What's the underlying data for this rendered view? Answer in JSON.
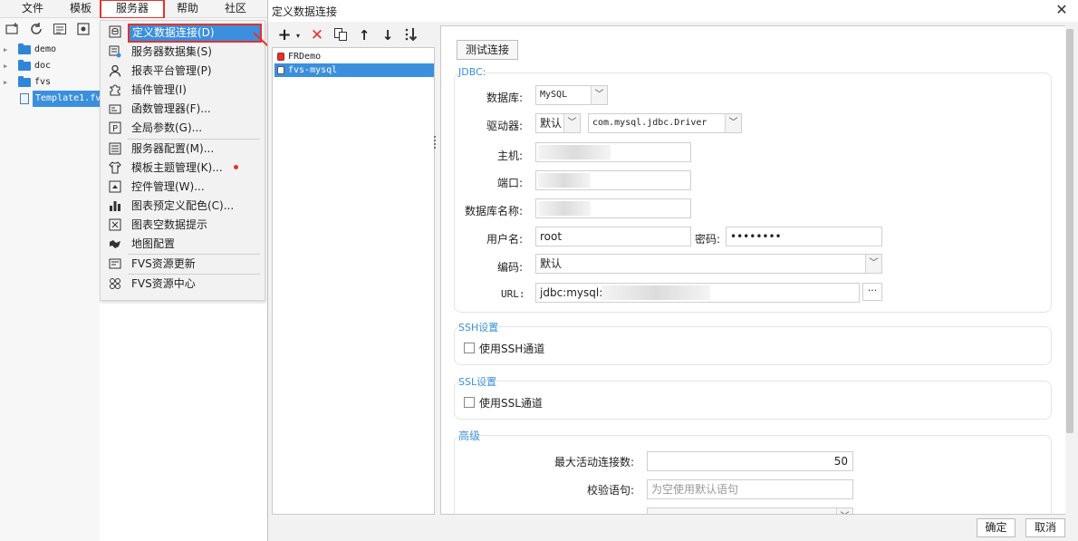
{
  "menubar": {
    "items": [
      "文件",
      "模板",
      "服务器",
      "帮助",
      "社区"
    ]
  },
  "tree": {
    "items": [
      {
        "label": "demo"
      },
      {
        "label": "doc"
      },
      {
        "label": "fvs"
      },
      {
        "label": "Template1.fv"
      }
    ]
  },
  "server_menu": {
    "items": [
      {
        "label": "定义数据连接(D)",
        "icon": "database-connection-icon"
      },
      {
        "label": "服务器数据集(S)",
        "icon": "server-dataset-icon"
      },
      {
        "label": "报表平台管理(P)",
        "icon": "user-icon"
      },
      {
        "label": "插件管理(I)",
        "icon": "puzzle-icon"
      },
      {
        "label": "函数管理器(F)...",
        "icon": "function-icon"
      },
      {
        "label": "全局参数(G)...",
        "icon": "parameter-icon"
      },
      {
        "label": "服务器配置(M)...",
        "icon": "server-config-icon"
      },
      {
        "label": "模板主题管理(K)...",
        "icon": "shirt-icon"
      },
      {
        "label": "控件管理(W)...",
        "icon": "widget-icon"
      },
      {
        "label": "图表预定义配色(C)...",
        "icon": "bar-chart-icon"
      },
      {
        "label": "图表空数据提示",
        "icon": "empty-chart-icon"
      },
      {
        "label": "地图配置",
        "icon": "map-icon"
      },
      {
        "label": "FVS资源更新",
        "icon": "resource-update-icon"
      },
      {
        "label": "FVS资源中心",
        "icon": "resource-center-icon"
      }
    ]
  },
  "dialog": {
    "title": "定义数据连接",
    "connections": [
      {
        "label": "FRDemo"
      },
      {
        "label": "fvs-mysql"
      }
    ],
    "test_button": "测试连接",
    "jdbc": {
      "section_title": "JDBC:",
      "database_label": "数据库:",
      "database_value": "MySQL",
      "driver_label": "驱动器:",
      "driver_mode": "默认",
      "driver_class": "com.mysql.jdbc.Driver",
      "host_label": "主机:",
      "port_label": "端口:",
      "dbname_label": "数据库名称:",
      "username_label": "用户名:",
      "username_value": "root",
      "password_label": "密码:",
      "password_value": "••••••••",
      "encoding_label": "编码:",
      "encoding_value": "默认",
      "url_label": "URL:",
      "url_value": "jdbc:mysql://",
      "url_more": "···"
    },
    "ssh": {
      "section_title": "SSH设置",
      "checkbox_label": "使用SSH通道",
      "checked": false
    },
    "ssl": {
      "section_title": "SSL设置",
      "checkbox_label": "使用SSL通道",
      "checked": false
    },
    "advanced": {
      "section_title": "高级",
      "max_active_label": "最大活动连接数:",
      "max_active_value": "50",
      "validation_label": "校验语句:",
      "validation_placeholder": "为空使用默认语句"
    },
    "ok_button": "确定",
    "cancel_button": "取消"
  },
  "colors": {
    "accent": "#3b8fdd",
    "highlight": "#e5322d",
    "section_title": "#3b8fdd"
  }
}
